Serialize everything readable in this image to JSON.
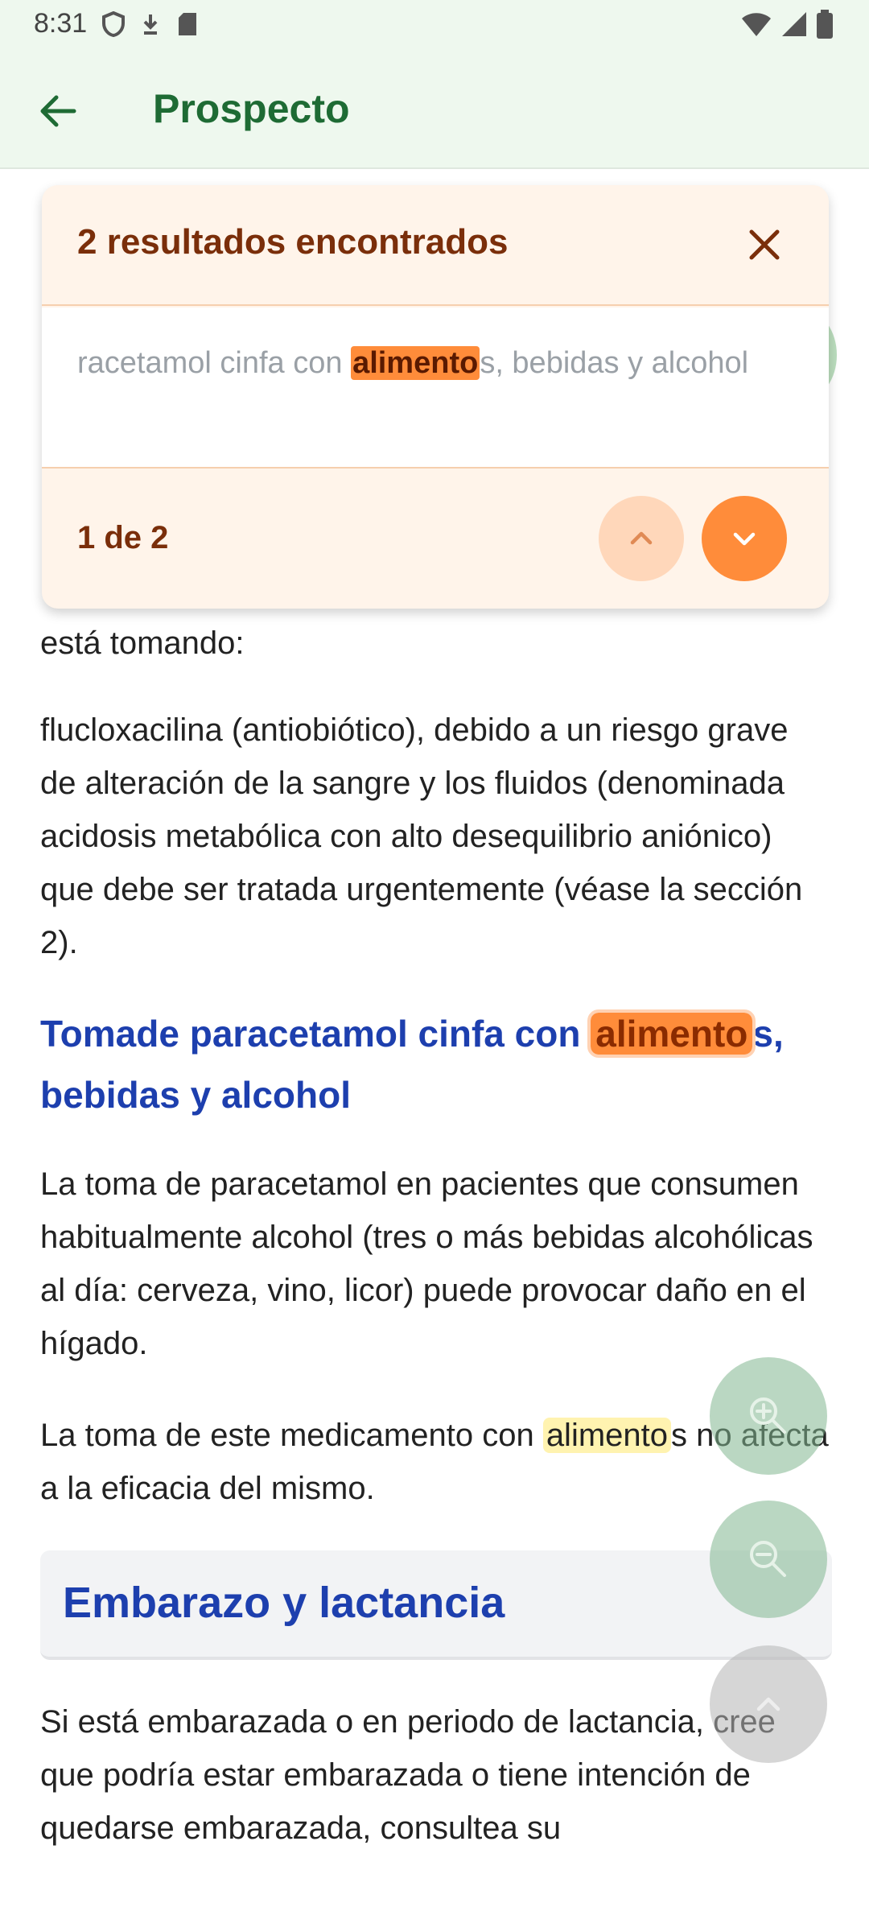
{
  "status_bar": {
    "time": "8:31",
    "icons": [
      "shield-icon",
      "download-icon",
      "sd-card-icon"
    ],
    "right_icons": [
      "wifi-icon",
      "signal-icon",
      "battery-icon"
    ]
  },
  "app_bar": {
    "title": "Prospecto",
    "back_icon": "arrow-back-icon"
  },
  "search_card": {
    "title": "2 resultados encontrados",
    "snippet_before": "racetamol cinfa con ",
    "snippet_match": "alimento",
    "snippet_after": "s, bebidas y alcohol",
    "counter": "1 de 2"
  },
  "content": {
    "p1": "está tomando:",
    "p2": "flucloxacilina (antiobiótico), debido a un riesgo grave de alteración de la sangre y los fluidos (denominada acidosis metabólica con alto desequilibrio aniónico) que debe ser tratada urgentemente (véase la sección 2).",
    "heading1_before": "Tomade paracetamol cinfa con ",
    "heading1_match": "alimento",
    "heading1_after": "s, bebidas y alcohol",
    "p3": "La toma de paracetamol en pacientes que consumen habitualmente alcohol (tres o más bebidas alcohólicas al día: cerveza, vino, licor) puede provocar daño en el hígado.",
    "p4_before": "La toma de este medicamento con ",
    "p4_match": "alimento",
    "p4_after": "s no afecta a la eficacia del mismo.",
    "section_title": "Embarazo y lactancia",
    "p5": "Si está embarazada o en periodo de lactancia, cree que podría estar embarazada o tiene intención de quedarse embarazada, consultea su"
  },
  "colors": {
    "accent_orange": "#ff8c3a",
    "app_green": "#1e6b34",
    "heading_blue": "#1d3fae"
  }
}
